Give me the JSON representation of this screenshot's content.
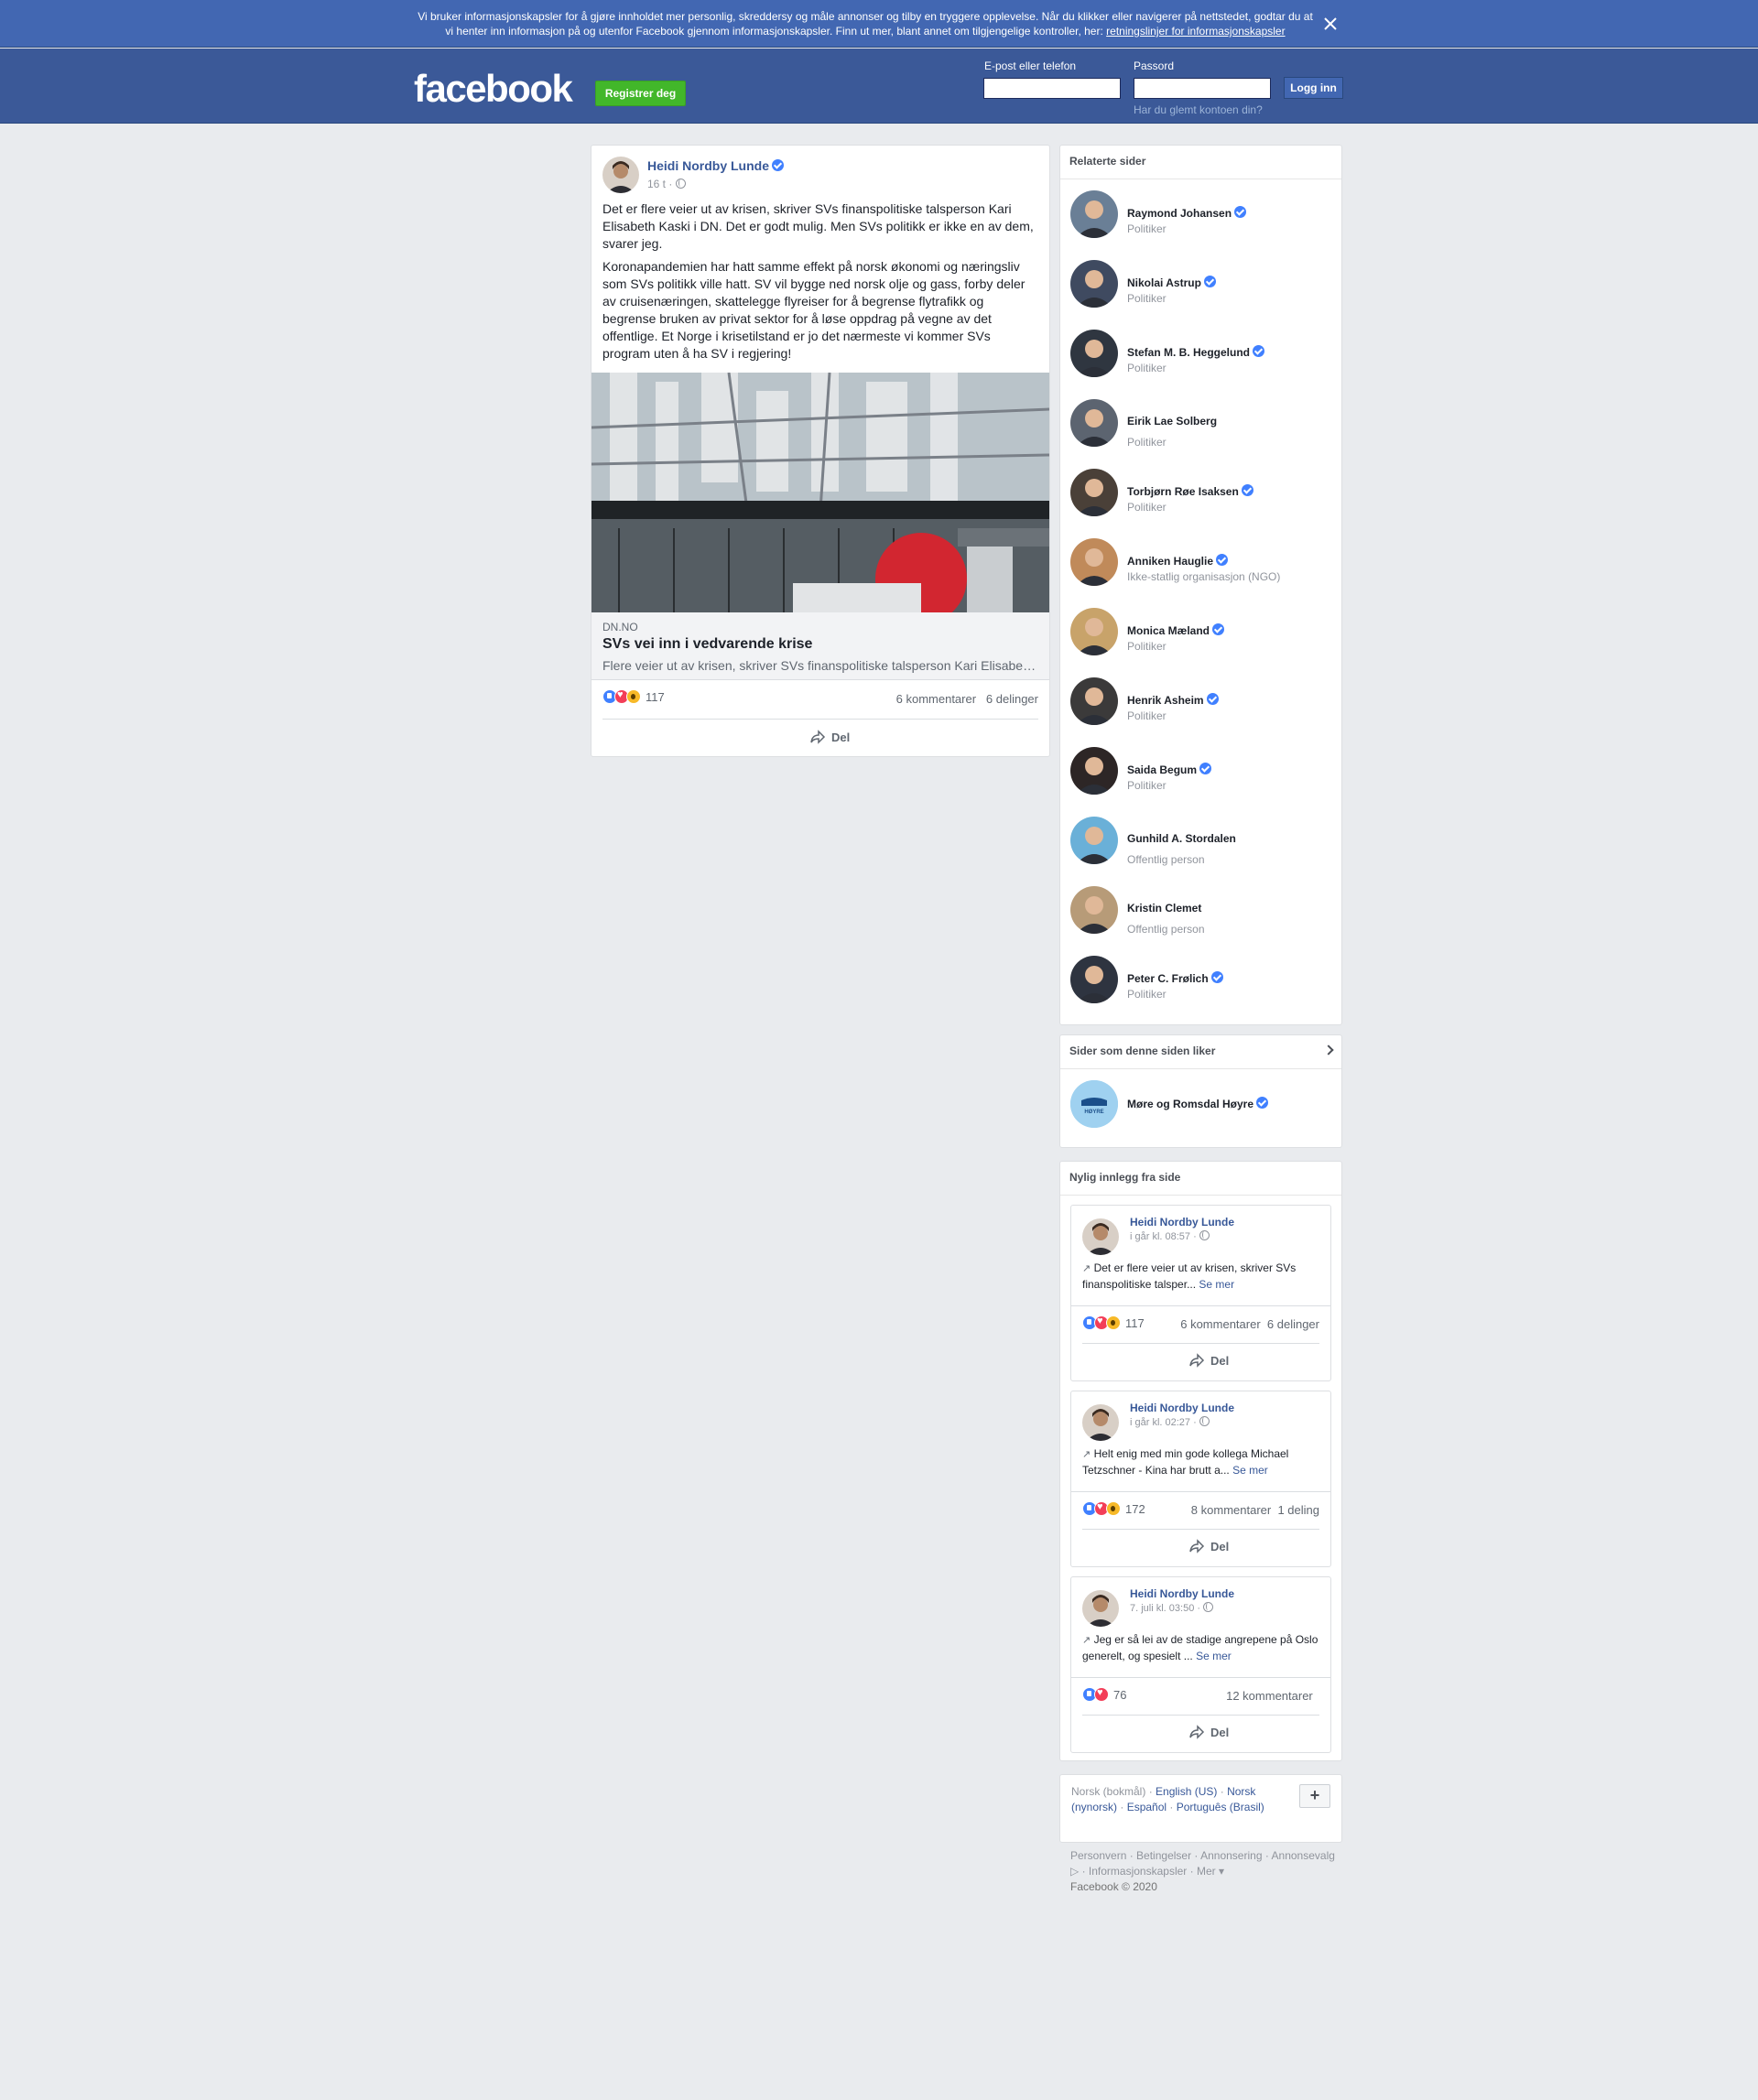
{
  "cookie_banner": {
    "text": "Vi bruker informasjonskapsler for å gjøre innholdet mer personlig, skreddersy og måle annonser og tilby en tryggere opplevelse. Når du klikker eller navigerer på nettstedet, godtar du at vi henter inn informasjon på og utenfor Facebook gjennom informasjonskapsler. Finn ut mer, blant annet om tilgjengelige kontroller, her:",
    "link": "retningslinjer for informasjonskapsler"
  },
  "header": {
    "logo": "facebook",
    "register_label": "Registrer deg",
    "email_label": "E-post eller telefon",
    "password_label": "Passord",
    "login_label": "Logg inn",
    "forgot_label": "Har du glemt kontoen din?"
  },
  "post": {
    "author": "Heidi Nordby Lunde",
    "time": "16 t ·",
    "paragraph1": "Det er flere veier ut av krisen, skriver SVs finanspolitiske talsperson Kari Elisabeth Kaski i DN. Det er godt mulig. Men SVs politikk er ikke en av dem, svarer jeg.",
    "paragraph2": "Koronapandemien har hatt samme effekt på norsk økonomi og næringsliv som SVs politikk ville hatt. SV vil bygge ned norsk olje og gass, forby deler av cruisenæringen, skattelegge flyreiser for å begrense flytrafikk og begrense bruken av privat sektor for å løse oppdrag på vegne av det offentlige. Et Norge i krisetilstand er jo det nærmeste vi kommer SVs program uten å ha SV i regjering!",
    "link_domain": "DN.NO",
    "link_title": "SVs vei inn i vedvarende krise",
    "link_desc": "Flere veier ut av krisen, skriver SVs finanspolitiske talsperson Kari Elisabeth Kaski i DN. Det er godt mulig.",
    "reaction_count": "117",
    "comments": "6 kommentarer",
    "shares": "6 delinger",
    "share_label": "Del"
  },
  "related": {
    "title": "Relaterte sider",
    "items": [
      {
        "name": "Raymond Johansen",
        "sub": "Politiker",
        "color": "#6a7f96"
      },
      {
        "name": "Nikolai Astrup",
        "sub": "Politiker",
        "color": "#3f4a60"
      },
      {
        "name": "Stefan M. B. Heggelund",
        "sub": "Politiker",
        "color": "#2f3640"
      },
      {
        "name": "Eirik Lae Solberg",
        "sub": "Politiker",
        "color": "#5c6470"
      },
      {
        "name": "Torbjørn Røe Isaksen",
        "sub": "Politiker",
        "color": "#4a4038"
      },
      {
        "name": "Anniken Hauglie",
        "sub": "Ikke-statlig organisasjon (NGO)",
        "color": "#c08a5a"
      },
      {
        "name": "Monica Mæland",
        "sub": "Politiker",
        "color": "#c8a36a"
      },
      {
        "name": "Henrik Asheim",
        "sub": "Politiker",
        "color": "#3b3a3a"
      },
      {
        "name": "Saida Begum",
        "sub": "Politiker",
        "color": "#2d2626"
      },
      {
        "name": "Gunhild A. Stordalen",
        "sub": "Offentlig person",
        "color": "#6ab0d8"
      },
      {
        "name": "Kristin Clemet",
        "sub": "Offentlig person",
        "color": "#b79b78"
      },
      {
        "name": "Peter C. Frølich",
        "sub": "Politiker",
        "color": "#2e3440"
      }
    ]
  },
  "likes": {
    "title": "Sider som denne siden liker",
    "item": "Møre og Romsdal Høyre",
    "logo_text": "HØYRE"
  },
  "recent": {
    "title": "Nylig innlegg fra side",
    "see_more": "Se mer",
    "posts": [
      {
        "author": "Heidi Nordby Lunde",
        "time": "i går kl. 08:57 ·",
        "text": "Det er flere veier ut av krisen, skriver SVs finanspolitiske talsper...",
        "reactions": "117",
        "comments": "6 kommentarer",
        "shares": "6 delinger",
        "share_label": "Del"
      },
      {
        "author": "Heidi Nordby Lunde",
        "time": "i går kl. 02:27 ·",
        "text": "Helt enig med min gode kollega Michael Tetzschner - Kina har brutt a...",
        "reactions": "172",
        "comments": "8 kommentarer",
        "shares": "1 deling",
        "share_label": "Del"
      },
      {
        "author": "Heidi Nordby Lunde",
        "time": "7. juli kl. 03:50 ·",
        "text": "Jeg er så lei av de stadige angrepene på Oslo generelt, og spesielt ...",
        "reactions": "76",
        "comments": "12 kommentarer",
        "shares": "",
        "share_label": "Del"
      }
    ]
  },
  "languages": {
    "current": "Norsk (bokmål)",
    "others": [
      "English (US)",
      "Norsk (nynorsk)",
      "Español",
      "Português (Brasil)"
    ],
    "plus": "+"
  },
  "footer": {
    "links": [
      "Personvern",
      "Betingelser",
      "Annonsering",
      "Annonsevalg",
      "Informasjonskapsler",
      "Mer"
    ],
    "copyright": "Facebook © 2020"
  },
  "colors": {
    "header_bg": "#3b5998",
    "banner_bg": "#4267b2",
    "register_green": "#42b72a",
    "link_blue": "#385898",
    "page_bg": "#e9ebee"
  }
}
